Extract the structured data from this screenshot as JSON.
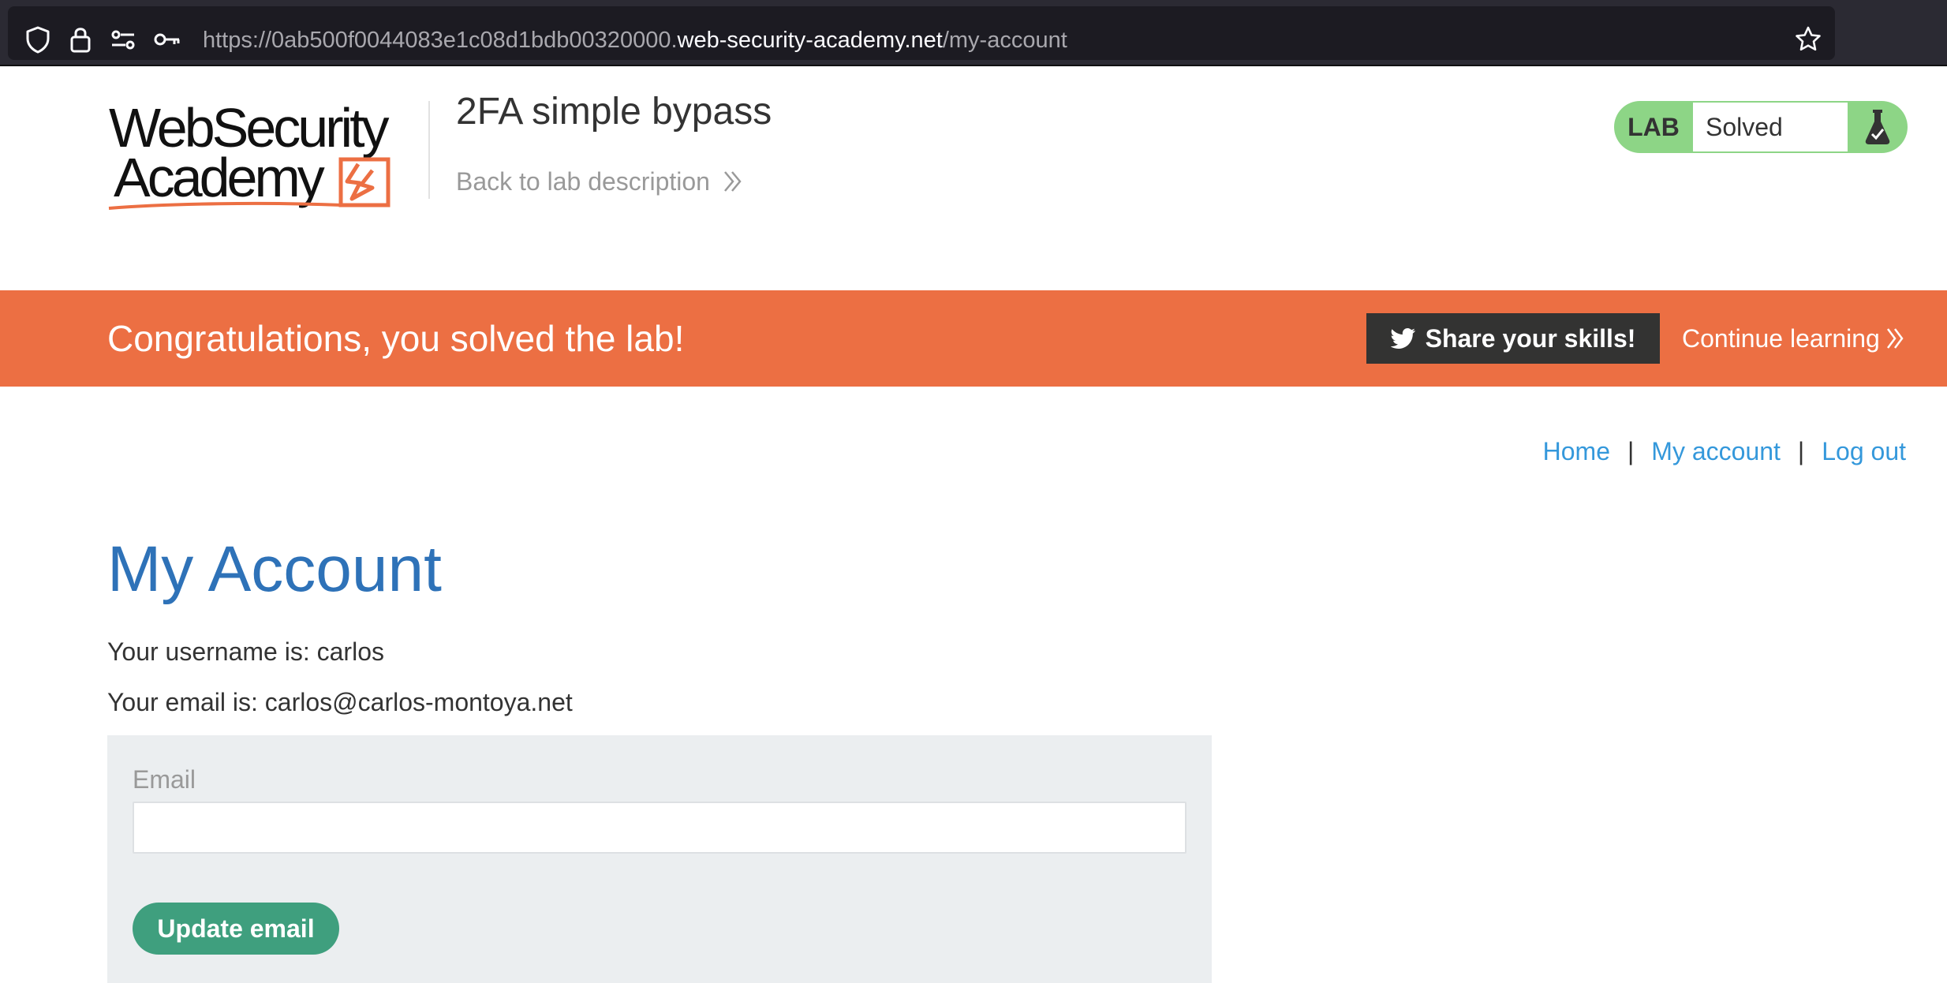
{
  "browser": {
    "url_prefix": "https://0ab500f0044083e1c08d1bdb00320000.",
    "url_host": "web-security-academy.net",
    "url_path": "/my-account",
    "icons": [
      "shield-icon",
      "lock-icon",
      "permissions-icon",
      "key-icon",
      "bookmark-star-icon"
    ]
  },
  "header": {
    "logo_line1": "WebSecurity",
    "logo_line2": "Academy",
    "lab_title": "2FA simple bypass",
    "back_link": "Back to lab description"
  },
  "lab_status": {
    "label": "LAB",
    "state": "Solved",
    "icon": "flask-icon",
    "color": "#8dd586"
  },
  "banner": {
    "message": "Congratulations, you solved the lab!",
    "share_label": "Share your skills!",
    "continue_label": "Continue learning",
    "color": "#ec6f43"
  },
  "nav": {
    "home": "Home",
    "my_account": "My account",
    "log_out": "Log out",
    "separator": "|"
  },
  "main": {
    "title": "My Account",
    "username_line": "Your username is: carlos",
    "email_line": "Your email is: carlos@carlos-montoya.net",
    "form": {
      "email_label": "Email",
      "email_value": "",
      "submit_label": "Update email"
    }
  }
}
